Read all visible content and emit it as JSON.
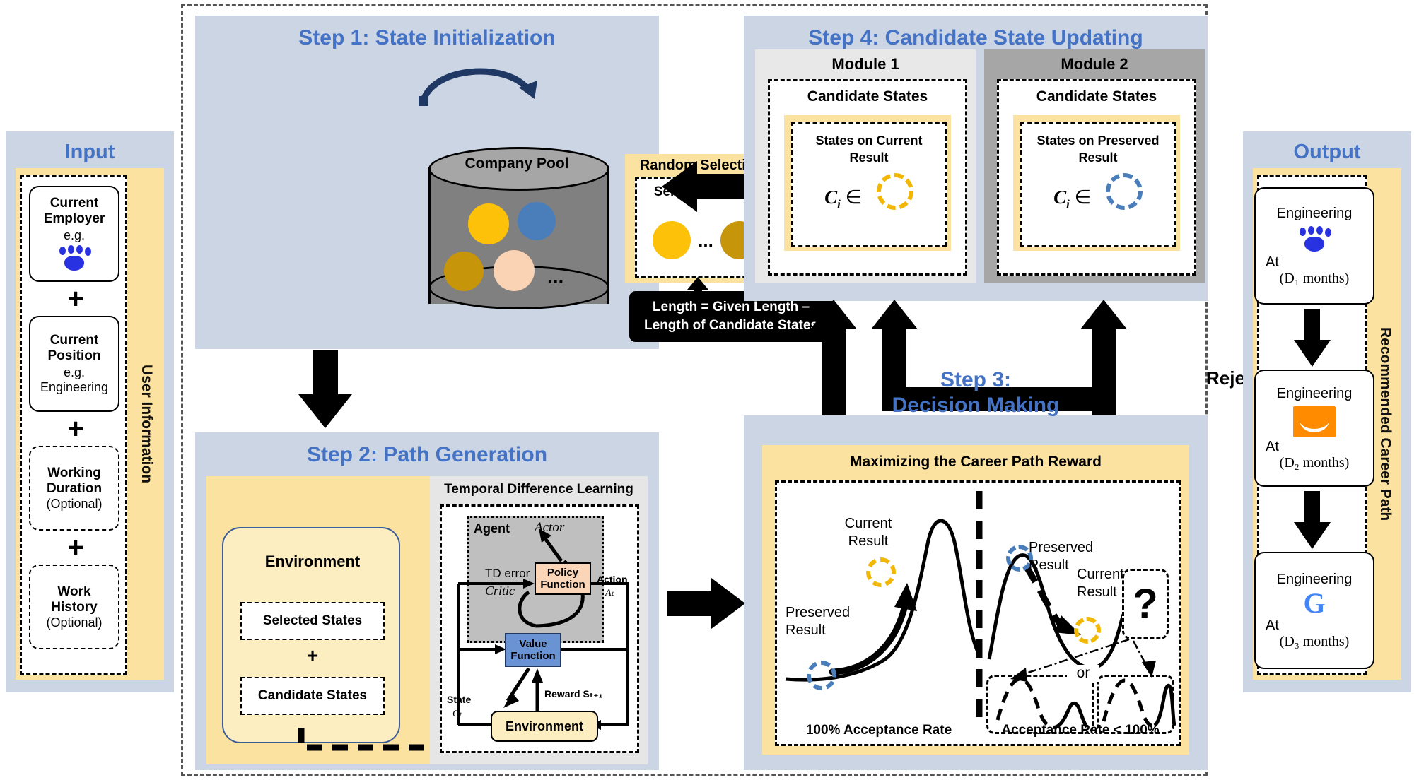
{
  "input": {
    "title": "Input",
    "vertical_label": "User Information",
    "items": [
      {
        "line1": "Current",
        "line2": "Employer",
        "line3": "e.g.",
        "logo": "baidu-logo",
        "optional": false
      },
      {
        "line1": "Current",
        "line2": "Position",
        "line3": "e.g.",
        "line4": "Engineering",
        "optional": false
      },
      {
        "line1": "Working",
        "line2": "Duration",
        "line3": "(Optional)",
        "optional": true
      },
      {
        "line1": "Work",
        "line2": "History",
        "line3": "(Optional)",
        "optional": true
      }
    ],
    "separator": "+"
  },
  "output": {
    "title": "Output",
    "vertical_label": "Recommended Career Path",
    "cards": [
      {
        "position": "Engineering",
        "at": "At",
        "duration": "(D₁ months)",
        "logo": "baidu-logo"
      },
      {
        "position": "Engineering",
        "at": "At",
        "duration": "(D₂ months)",
        "logo": "amazon-logo"
      },
      {
        "position": "Engineering",
        "at": "At",
        "duration": "(D₃ months)",
        "logo": "google-logo"
      }
    ]
  },
  "step1": {
    "title": "Step 1: State Initialization",
    "pool_label": "Company Pool",
    "pool_ellipsis": "...",
    "random_selection": "Random Selection",
    "selected_states": "Selected States",
    "selected_ellipsis": "...",
    "length_formula_line1": "Length = Given Length –",
    "length_formula_line2": "Length of Candidate States"
  },
  "step2": {
    "title": "Step 2: Path Generation",
    "environment_title": "Environment",
    "selected_states": "Selected States",
    "plus": "+",
    "candidate_states": "Candidate States",
    "tdl_title": "Temporal Difference Learning",
    "agent": "Agent",
    "actor": "Actor",
    "critic": "Critic",
    "td_error": "TD error",
    "policy_function_l1": "Policy",
    "policy_function_l2": "Function",
    "value_function_l1": "Value",
    "value_function_l2": "Function",
    "environment_box": "Environment",
    "action_label": "Action",
    "action_sym": "Aₜ",
    "state_label": "State",
    "state_sym": "Cₜ",
    "reward_label": "Reward Sₜ₊₁"
  },
  "step3": {
    "title_l1": "Step 3:",
    "title_l2": "Decision Making",
    "panel_title": "Maximizing the Career Path Reward",
    "left_current_l1": "Current",
    "left_current_l2": "Result",
    "left_preserved_l1": "Preserved",
    "left_preserved_l2": "Result",
    "left_caption": "100% Acceptance Rate",
    "right_preserved_l1": "Preserved",
    "right_preserved_l2": "Result",
    "right_current_l1": "Current",
    "right_current_l2": "Result",
    "question_mark": "?",
    "or_label": "or",
    "right_caption": "Acceptance Rate < 100%",
    "reject_label": "Reject"
  },
  "step4": {
    "title": "Step 4: Candidate State Updating",
    "modules": [
      {
        "name": "Module 1",
        "candidate_states": "Candidate States",
        "states_l1": "States on Current",
        "states_l2": "Result",
        "formula": "C",
        "formula_sub": "i",
        "formula_in": "∈",
        "ring_color": "#f2b705"
      },
      {
        "name": "Module 2",
        "candidate_states": "Candidate States",
        "states_l1": "States on Preserved",
        "states_l2": "Result",
        "formula": "C",
        "formula_sub": "i",
        "formula_in": "∈",
        "ring_color": "#4a7ebb"
      }
    ]
  },
  "colors": {
    "accent_blue": "#4472C4",
    "panel_blue": "#ccd5e4",
    "panel_yellow": "#fbe2a0",
    "ring_yellow": "#f2b705",
    "ring_blue": "#4a7ebb",
    "pool_gray": "#808080",
    "module2_gray": "#a6a6a6",
    "baidu_blue": "#2932e1",
    "amazon_orange": "#ff8c00"
  }
}
